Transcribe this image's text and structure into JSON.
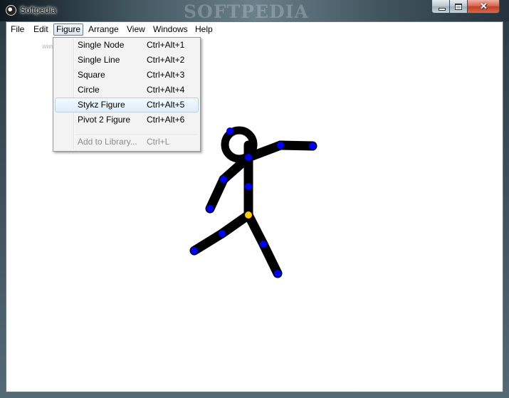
{
  "window": {
    "title": "Softpedia",
    "watermark": "SOFTPEDIA",
    "menubar_watermark": "www.softpedia.com",
    "app_icon": "pivot-app-icon",
    "controls": {
      "minimize_icon": "minimize-icon",
      "maximize_icon": "maximize-icon",
      "close_icon": "close-icon",
      "close_glyph": "✕"
    }
  },
  "menubar": {
    "items": [
      {
        "label": "File"
      },
      {
        "label": "Edit"
      },
      {
        "label": "Figure"
      },
      {
        "label": "Arrange"
      },
      {
        "label": "View"
      },
      {
        "label": "Windows"
      },
      {
        "label": "Help"
      }
    ],
    "active": "Figure"
  },
  "figure_menu": {
    "items": [
      {
        "label": "Single Node",
        "shortcut": "Ctrl+Alt+1"
      },
      {
        "label": "Single Line",
        "shortcut": "Ctrl+Alt+2"
      },
      {
        "label": "Square",
        "shortcut": "Ctrl+Alt+3"
      },
      {
        "label": "Circle",
        "shortcut": "Ctrl+Alt+4"
      },
      {
        "label": "Stykz Figure",
        "shortcut": "Ctrl+Alt+5",
        "highlighted": true
      },
      {
        "label": "Pivot 2 Figure",
        "shortcut": "Ctrl+Alt+6"
      },
      {
        "label": "Add to Library...",
        "shortcut": "Ctrl+L",
        "disabled": true
      }
    ]
  },
  "canvas": {
    "figure": "stick-figure",
    "colors": {
      "limb": "#000000",
      "node": "#0000ff",
      "origin_node": "#ffcc00",
      "background": "#ffffff"
    }
  }
}
